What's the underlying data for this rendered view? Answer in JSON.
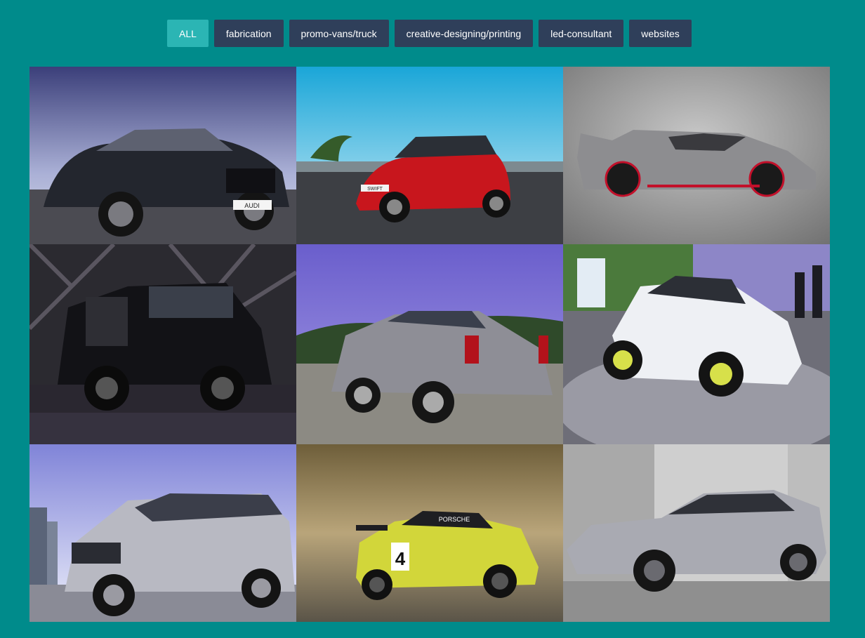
{
  "filters": [
    {
      "label": "ALL",
      "active": true
    },
    {
      "label": "fabrication",
      "active": false
    },
    {
      "label": "promo-vans/truck",
      "active": false
    },
    {
      "label": "creative-designing/printing",
      "active": false
    },
    {
      "label": "led-consultant",
      "active": false
    },
    {
      "label": "websites",
      "active": false
    }
  ],
  "gallery": {
    "items": [
      {
        "icon": "audi-hatchback-photo",
        "car_color": "#2a2d36",
        "sky": "#7a7fb0"
      },
      {
        "icon": "red-suzuki-swift-photo",
        "car_color": "#c8161d",
        "sky": "#4fc3dd"
      },
      {
        "icon": "silver-lamborghini-photo",
        "car_color": "#8d8d90",
        "sky": "#9a9a9a"
      },
      {
        "icon": "black-rolls-royce-suv-photo",
        "car_color": "#121216",
        "sky": "#3a3640"
      },
      {
        "icon": "silver-cadillac-suv-photo",
        "car_color": "#8e8e96",
        "sky": "#7b6fd0"
      },
      {
        "icon": "white-porsche-taycan-photo",
        "car_color": "#eef0f4",
        "sky": "#8d86c7"
      },
      {
        "icon": "silver-toyota-avanza-photo",
        "car_color": "#b8b9c2",
        "sky": "#d7dcf3"
      },
      {
        "icon": "porsche-race-car-photo",
        "car_color": "#d2d63a",
        "sky": "#8a7a52"
      },
      {
        "icon": "silver-sedan-photo",
        "car_color": "#a9aab2",
        "sky": "#c9c9c9"
      }
    ],
    "plate_text": "AUDI",
    "badge_swift": "SWIFT",
    "race_number": "4",
    "race_brand": "PORSCHE"
  }
}
